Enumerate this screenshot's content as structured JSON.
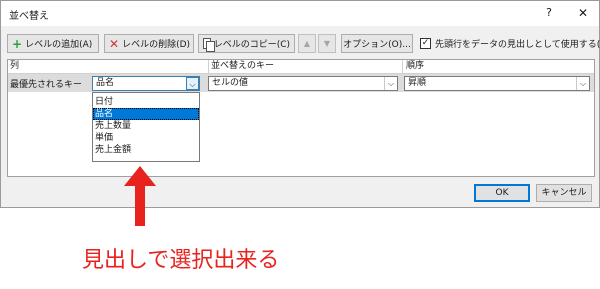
{
  "dialog": {
    "title": "並べ替え",
    "help": "?",
    "close": "✕"
  },
  "toolbar": {
    "add_level": "レベルの追加(A)",
    "delete_level": "レベルの削除(D)",
    "copy_level": "レベルのコピー(C)",
    "move_up": "▲",
    "move_down": "▼",
    "options": "オプション(O)...",
    "header_checkbox_label": "先頭行をデータの見出しとして使用する(H)",
    "header_checkbox_checked": true
  },
  "grid": {
    "headers": {
      "column": "列",
      "sort_on": "並べ替えのキー",
      "order": "順序"
    },
    "row": {
      "label": "最優先されるキー",
      "column_value": "品名",
      "sort_on_value": "セルの値",
      "order_value": "昇順"
    },
    "dropdown_options": [
      "日付",
      "品名",
      "売上数量",
      "単価",
      "売上金額"
    ],
    "selected_option_index": 1
  },
  "buttons": {
    "ok": "OK",
    "cancel": "キャンセル"
  },
  "annotation": {
    "text": "見出しで選択出来る",
    "color": "#e8231f"
  },
  "icons": {
    "add": "plus-icon",
    "delete": "x-icon",
    "copy": "copy-icon",
    "dropdown": "chevron-down-icon",
    "checkbox": "checkmark-icon"
  }
}
